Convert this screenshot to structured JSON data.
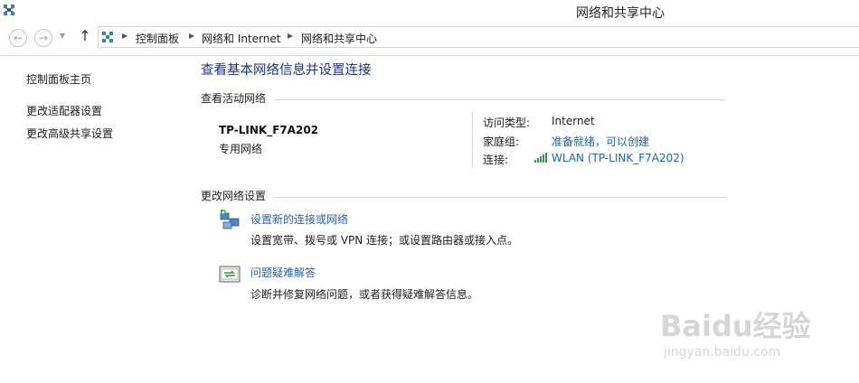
{
  "window": {
    "title": "网络和共享中心",
    "icon": "network-center-icon"
  },
  "navigation": {
    "back_icon": "back-arrow-icon",
    "forward_icon": "forward-arrow-icon",
    "recent_icon": "chevron-down-icon",
    "up_icon": "up-arrow-icon",
    "breadcrumb": [
      "控制面板",
      "网络和 Internet",
      "网络和共享中心"
    ]
  },
  "sidebar": {
    "items": [
      {
        "label": "控制面板主页"
      },
      {
        "label": "更改适配器设置"
      },
      {
        "label": "更改高级共享设置"
      }
    ]
  },
  "main": {
    "title": "查看基本网络信息并设置连接",
    "active_networks": {
      "heading": "查看活动网络",
      "network_name": "TP-LINK_F7A202",
      "network_category": "专用网络",
      "access_type_label": "访问类型:",
      "access_type_value": "Internet",
      "homegroup_label": "家庭组:",
      "homegroup_value": "准备就绪，可以创建",
      "connection_label": "连接:",
      "connection_value": "WLAN (TP-LINK_F7A202)",
      "connection_icon": "wifi-signal-icon"
    },
    "change_settings": {
      "heading": "更改网络设置",
      "tasks": [
        {
          "icon": "new-connection-icon",
          "label": "设置新的连接或网络",
          "description": "设置宽带、拨号或 VPN 连接；或设置路由器或接入点。"
        },
        {
          "icon": "troubleshoot-icon",
          "label": "问题疑难解答",
          "description": "诊断并修复网络问题，或者获得疑难解答信息。"
        }
      ]
    }
  },
  "watermark": {
    "brand": "Baidu经验",
    "url": "jingyan.baidu.com"
  }
}
